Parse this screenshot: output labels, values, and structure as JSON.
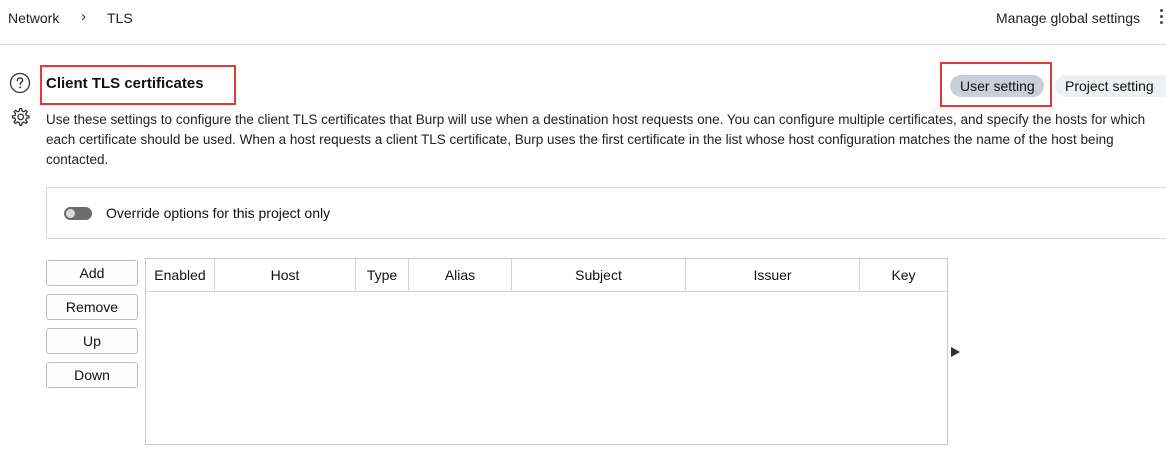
{
  "breadcrumb": {
    "items": [
      "Network",
      "TLS"
    ],
    "separator": "›"
  },
  "header": {
    "manage_label": "Manage global settings"
  },
  "section": {
    "title": "Client TLS certificates",
    "description": "Use these settings to configure the client TLS certificates that Burp will use when a destination host requests one. You can configure multiple certificates, and specify the hosts for which each certificate should be used. When a host requests a client TLS certificate, Burp uses the first certificate in the list whose host configuration matches the name of the host being contacted."
  },
  "scope_tabs": {
    "user_label": "User setting",
    "project_label": "Project setting",
    "active": "user"
  },
  "override": {
    "label": "Override options for this project only",
    "enabled": false
  },
  "actions": {
    "add": "Add",
    "remove": "Remove",
    "up": "Up",
    "down": "Down"
  },
  "table": {
    "columns": [
      "Enabled",
      "Host",
      "Type",
      "Alias",
      "Subject",
      "Issuer",
      "Key"
    ],
    "rows": []
  },
  "icons": {
    "help": "help-circle-icon",
    "settings": "gear-icon",
    "more": "kebab-menu-icon",
    "expand": "triangle-right-icon"
  },
  "colors": {
    "highlight_border": "#e53935",
    "active_pill": "#c8cfd8",
    "inactive_pill": "#eef0f2"
  }
}
